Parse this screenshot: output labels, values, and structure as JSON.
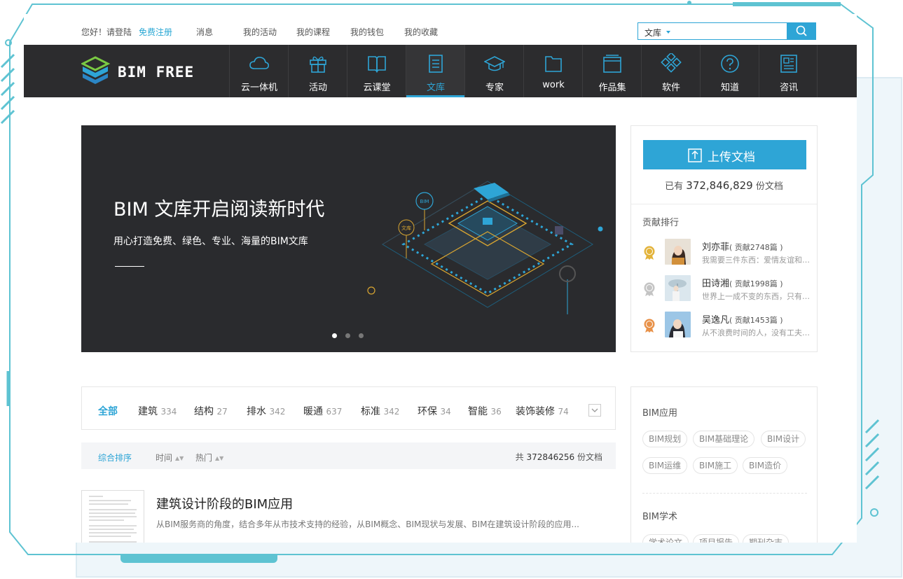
{
  "topbar": {
    "greeting": "您好！请登陆",
    "register": "免费注册",
    "links": [
      "消息",
      "我的活动",
      "我的课程",
      "我的钱包",
      "我的收藏"
    ],
    "search": {
      "scope": "文库",
      "value": "",
      "placeholder": ""
    }
  },
  "nav": {
    "logo": "BIM FREE",
    "items": [
      {
        "label": "云一体机",
        "icon": "cloud-icon"
      },
      {
        "label": "活动",
        "icon": "gift-icon"
      },
      {
        "label": "云课堂",
        "icon": "open-book-icon"
      },
      {
        "label": "文库",
        "icon": "document-icon"
      },
      {
        "label": "专家",
        "icon": "graduation-cap-icon"
      },
      {
        "label": "work",
        "icon": "folder-icon"
      },
      {
        "label": "作品集",
        "icon": "portfolio-icon"
      },
      {
        "label": "软件",
        "icon": "diamond-grid-icon"
      },
      {
        "label": "知道",
        "icon": "question-circle-icon"
      },
      {
        "label": "咨讯",
        "icon": "newspaper-icon"
      }
    ],
    "active": "文库"
  },
  "banner": {
    "title": "BIM 文库开启阅读新时代",
    "subtitle": "用心打造免费、绿色、专业、海量的BIM文库",
    "badge_bim": "BIM",
    "badge_wenku": "文库"
  },
  "upload": {
    "button": "上传文档",
    "count_prefix": "已有",
    "count": "372,846,829",
    "count_suffix": "份文档"
  },
  "ranking": {
    "title": "贡献排行",
    "rows": [
      {
        "name": "刘亦菲",
        "count": "( 贡献2748篇 )",
        "desc": "我需要三件东西：爱情友谊和图书...",
        "medal": "#e3b33a"
      },
      {
        "name": "田诗湘",
        "count": "( 贡献1998篇 )",
        "desc": "世界上一成不变的东西，只有“任...",
        "medal": "#b9b9b9"
      },
      {
        "name": "吴逸凡",
        "count": "( 贡献1453篇 )",
        "desc": "从不浪费时间的人，没有工夫抱怨...",
        "medal": "#e8924a"
      }
    ]
  },
  "categories": [
    {
      "name": "全部",
      "count": ""
    },
    {
      "name": "建筑",
      "count": "334"
    },
    {
      "name": "结构",
      "count": "27"
    },
    {
      "name": "排水",
      "count": "342"
    },
    {
      "name": "暖通",
      "count": "637"
    },
    {
      "name": "标准",
      "count": "342"
    },
    {
      "name": "环保",
      "count": "34"
    },
    {
      "name": "智能",
      "count": "36"
    },
    {
      "name": "装饰装修",
      "count": "74"
    }
  ],
  "sort": {
    "options": [
      "综合排序",
      "时间",
      "热门"
    ],
    "total_prefix": "共",
    "total": "372846256",
    "total_suffix": "份文档"
  },
  "doc": {
    "title": "建筑设计阶段的BIM应用",
    "desc": "从BIM服务商的角度，结合多年从市技术支持的经验，从BIM概念、BIM现状与发展、BIM在建筑设计阶段的应用..."
  },
  "tags": {
    "sec1": {
      "title": "BIM应用",
      "items": [
        "BIM规划",
        "BIM基础理论",
        "BIM设计",
        "BIM运维",
        "BIM施工",
        "BIM造价"
      ]
    },
    "sec2": {
      "title": "BIM学术",
      "items": [
        "学术论文",
        "项目报告",
        "期刊杂志"
      ]
    }
  },
  "colors": {
    "accent": "#2ea5d6",
    "nav_bg": "#2c2c2e",
    "frame": "#5ec3d2"
  }
}
